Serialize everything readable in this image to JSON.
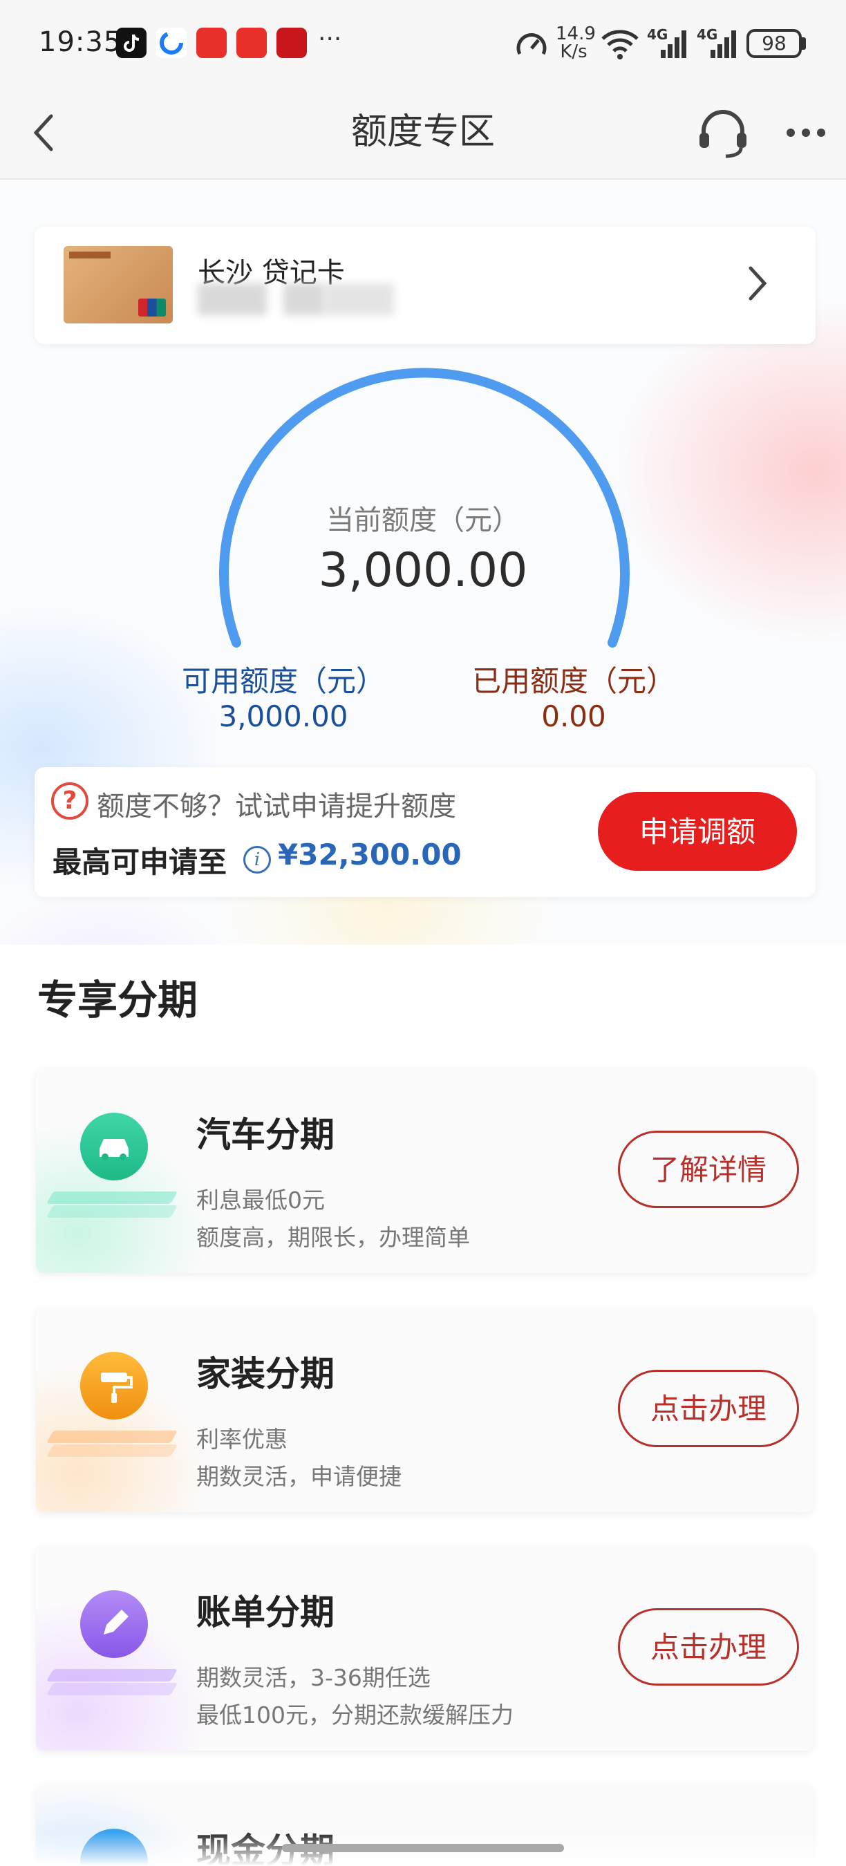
{
  "status": {
    "time": "19:35",
    "net_speed_top": "14.9",
    "net_speed_bottom": "K/s",
    "signal1": "4G",
    "signal2": "4G",
    "battery": "98",
    "more_dots": "···"
  },
  "nav": {
    "title": "额度专区"
  },
  "card": {
    "name": "长沙 贷记卡"
  },
  "limit": {
    "current_label": "当前额度（元）",
    "current_value": "3,000.00",
    "available_label": "可用额度（元）",
    "available_value": "3,000.00",
    "used_label": "已用额度（元）",
    "used_value": "0.00",
    "used_fraction": 0
  },
  "promo": {
    "question": "额度不够？试试申请提升额度",
    "max_label": "最高可申请至",
    "max_amount": "¥32,300.00",
    "apply_button": "申请调额"
  },
  "section": {
    "title": "专享分期"
  },
  "installments": [
    {
      "title": "汽车分期",
      "line1": "利息最低0元",
      "line2": "额度高，期限长，办理简单",
      "button": "了解详情",
      "icon": "car-icon",
      "color": "#2fc79a"
    },
    {
      "title": "家装分期",
      "line1": "利率优惠",
      "line2": "期数灵活，申请便捷",
      "button": "点击办理",
      "icon": "paint-roller-icon",
      "color": "#f7a21c"
    },
    {
      "title": "账单分期",
      "line1": "期数灵活，3-36期任选",
      "line2": "最低100元，分期还款缓解压力",
      "button": "点击办理",
      "icon": "pencil-icon",
      "color": "#9b6cf0"
    },
    {
      "title": "现金分期",
      "line1": "",
      "line2": "",
      "button": "",
      "icon": "cash-icon",
      "color": "#2a8de6"
    }
  ],
  "colors": {
    "accent_red": "#e61e1e",
    "gauge_blue": "#4f9bef",
    "available_blue": "#1b4f9a",
    "used_brown": "#8a2d12"
  }
}
